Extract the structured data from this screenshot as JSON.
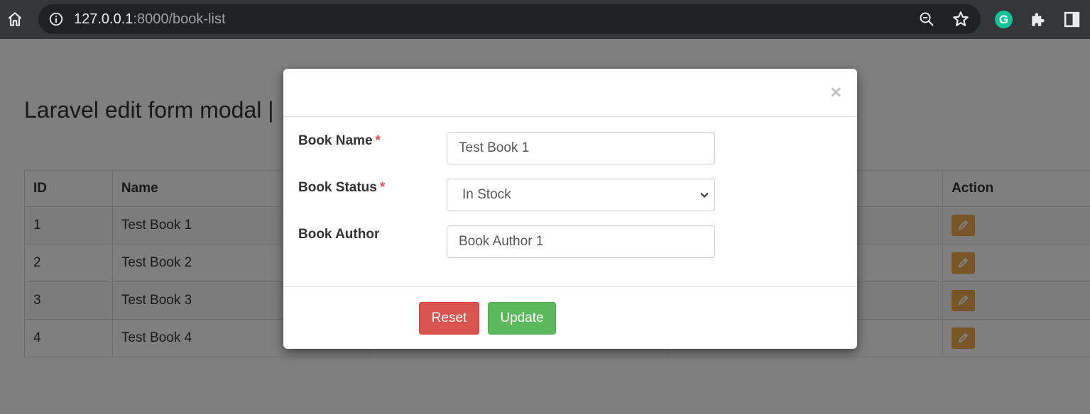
{
  "browser": {
    "url_host": "127.0.0.1",
    "url_path": ":8000/book-list"
  },
  "page": {
    "heading": "Laravel edit form modal | ",
    "table": {
      "headers": [
        "ID",
        "Name",
        "",
        "",
        "Action"
      ],
      "rows": [
        {
          "id": "1",
          "name": "Test Book 1"
        },
        {
          "id": "2",
          "name": "Test Book 2"
        },
        {
          "id": "3",
          "name": "Test Book 3"
        },
        {
          "id": "4",
          "name": "Test Book 4"
        }
      ]
    }
  },
  "modal": {
    "close_label": "×",
    "fields": {
      "book_name": {
        "label": "Book Name",
        "required_mark": "*",
        "value": "Test Book 1"
      },
      "book_status": {
        "label": "Book Status",
        "required_mark": "*",
        "value": "In Stock"
      },
      "book_author": {
        "label": "Book Author",
        "value": "Book Author 1"
      }
    },
    "buttons": {
      "reset": "Reset",
      "update": "Update"
    }
  },
  "colors": {
    "reset": "#d9534f",
    "update": "#5cb85c",
    "edit": "#f0ad4e",
    "grammarly": "#15c39a"
  }
}
